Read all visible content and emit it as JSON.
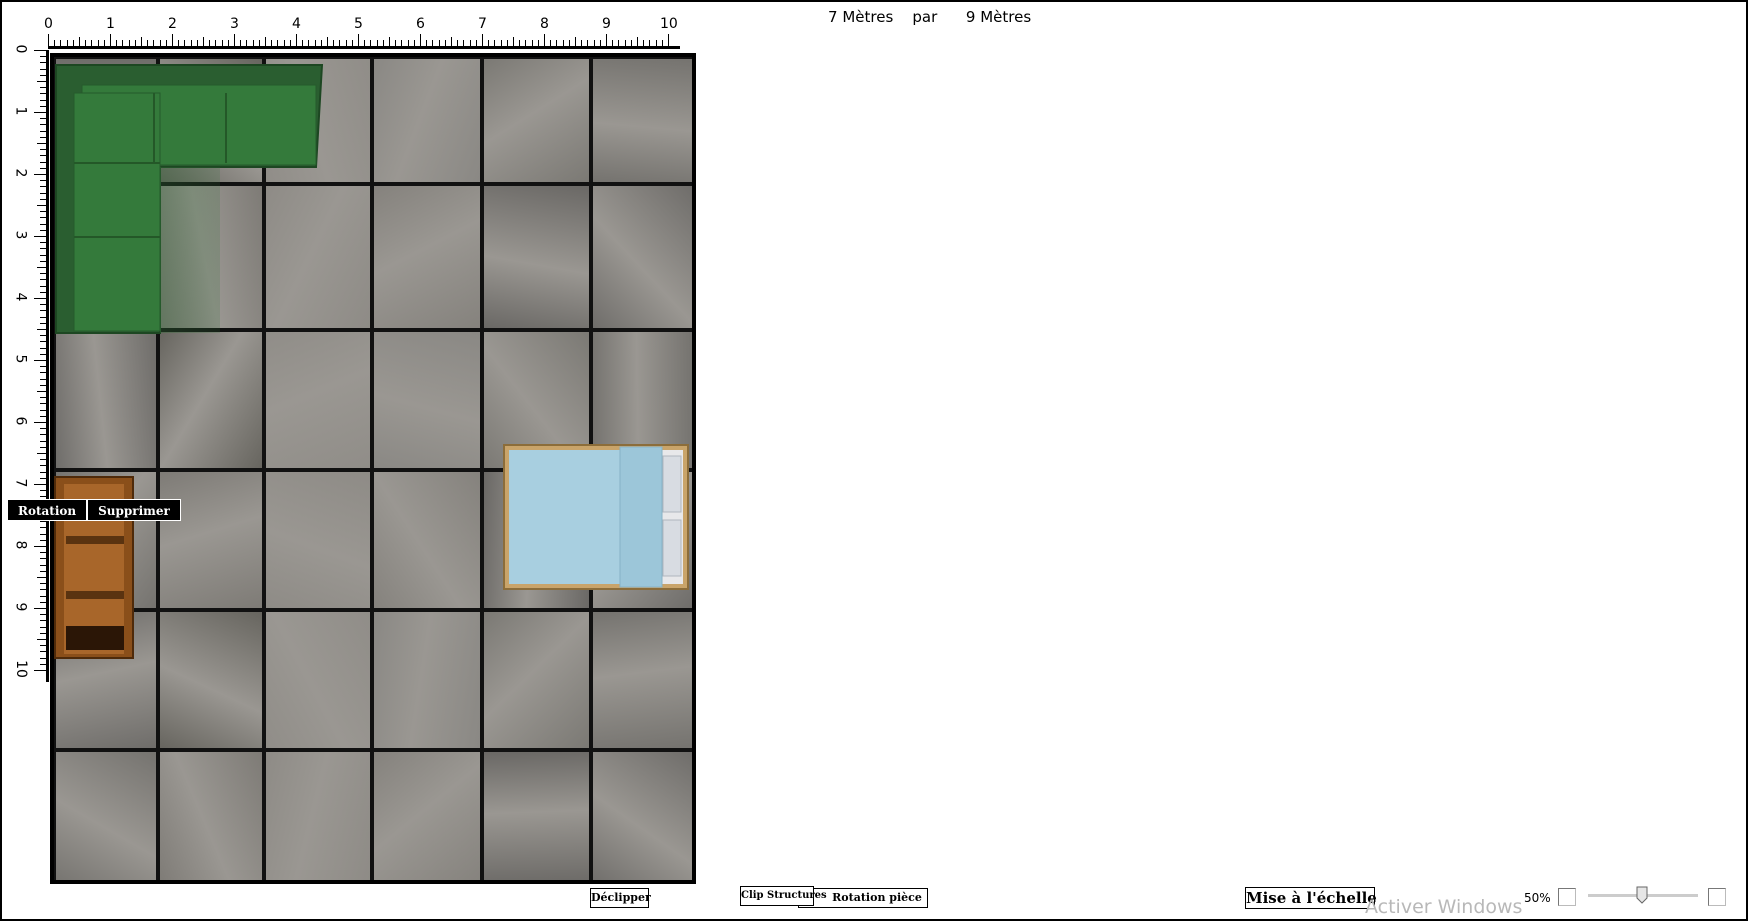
{
  "dimensions": {
    "width_value": "7",
    "width_unit": "Mètres",
    "by": "par",
    "length_value": "9",
    "length_unit": "Mètres"
  },
  "ruler_top": {
    "labels": [
      "0",
      "1",
      "2",
      "3",
      "4",
      "5",
      "6",
      "7",
      "8",
      "9",
      "10"
    ]
  },
  "ruler_left": {
    "labels": [
      "0",
      "1",
      "2",
      "3",
      "4",
      "5",
      "6",
      "7",
      "8",
      "9",
      "10"
    ]
  },
  "furniture": [
    {
      "name": "sofa",
      "color": "#2f6b35"
    },
    {
      "name": "bed",
      "color": "#a8cfe0"
    },
    {
      "name": "shelf",
      "color": "#8a4f1a"
    }
  ],
  "context_menu": {
    "rotation_label": "Rotation",
    "delete_label": "Supprimer"
  },
  "toolbar": {
    "declip_label": "Déclipper",
    "clip_structures_label": "Clip Structures",
    "rotate_room_label": "Rotation pièce",
    "scale_label": "Mise à l'échelle",
    "zoom_percent": "50%",
    "zoom_level": 0.5
  },
  "watermark": "Activer Windows",
  "colors": {
    "floor_base": "#7c7a76",
    "tile_border": "#111111",
    "sofa": "#2f6b35",
    "bed_blanket": "#a8cfe0",
    "shelf_wood": "#8a4f1a"
  }
}
